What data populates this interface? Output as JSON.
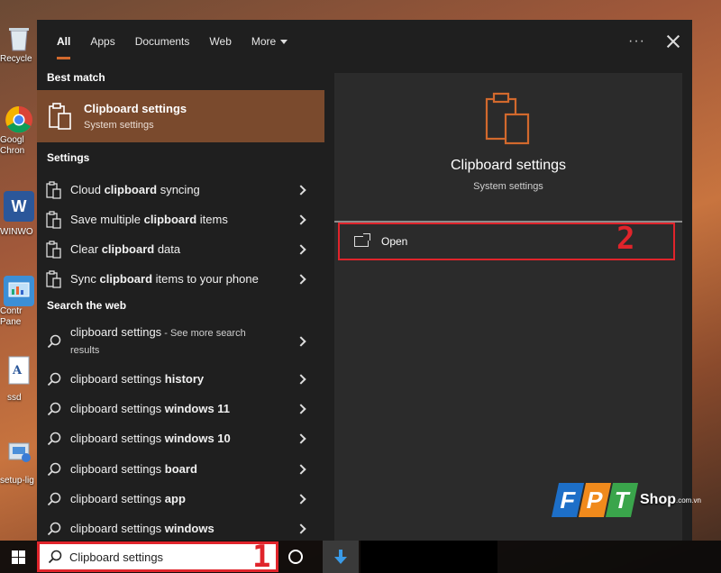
{
  "desktop": {
    "icons": [
      {
        "label": "Recycle"
      },
      {
        "label": "Googl\nChron"
      },
      {
        "label": "WINWO"
      },
      {
        "label": "Contr\nPane"
      },
      {
        "label": "ssd"
      },
      {
        "label": "setup-lig"
      }
    ]
  },
  "start": {
    "tabs": [
      {
        "label": "All",
        "active": true
      },
      {
        "label": "Apps"
      },
      {
        "label": "Documents"
      },
      {
        "label": "Web"
      },
      {
        "label": "More"
      }
    ],
    "more_options": "···",
    "best_match": {
      "header": "Best match",
      "title": "Clipboard settings",
      "subtitle": "System settings"
    },
    "settings": {
      "header": "Settings",
      "items": [
        {
          "pre": "Cloud ",
          "bold": "clipboard",
          "post": " syncing"
        },
        {
          "pre": "Save multiple ",
          "bold": "clipboard",
          "post": " items"
        },
        {
          "pre": "Clear ",
          "bold": "clipboard",
          "post": " data"
        },
        {
          "pre": "Sync ",
          "bold": "clipboard",
          "post": " items to your phone"
        }
      ]
    },
    "web": {
      "header": "Search the web",
      "first": {
        "text": "clipboard settings",
        "suffix": " - See more search",
        "line2": "results"
      },
      "items": [
        {
          "pre": "clipboard settings ",
          "bold": "history"
        },
        {
          "pre": "clipboard settings ",
          "bold": "windows 11"
        },
        {
          "pre": "clipboard settings ",
          "bold": "windows 10"
        },
        {
          "pre": "clipboard settings ",
          "bold": "board"
        },
        {
          "pre": "clipboard settings ",
          "bold": "app"
        },
        {
          "pre": "clipboard settings ",
          "bold": "windows"
        }
      ]
    },
    "preview": {
      "title": "Clipboard settings",
      "subtitle": "System settings",
      "open_label": "Open",
      "step_marker": "2"
    }
  },
  "taskbar": {
    "search_value": "Clipboard settings",
    "step_marker": "1"
  },
  "watermark": {
    "letters": [
      "F",
      "P",
      "T"
    ],
    "shop": "Shop",
    "domain": ".com.vn"
  },
  "colors": {
    "accent": "#d2692d",
    "highlight": "#7a4a2d",
    "annotation": "#e0242b",
    "fpt_blue": "#1d6fc8",
    "fpt_orange": "#f08a1c",
    "fpt_green": "#3aa54b"
  }
}
